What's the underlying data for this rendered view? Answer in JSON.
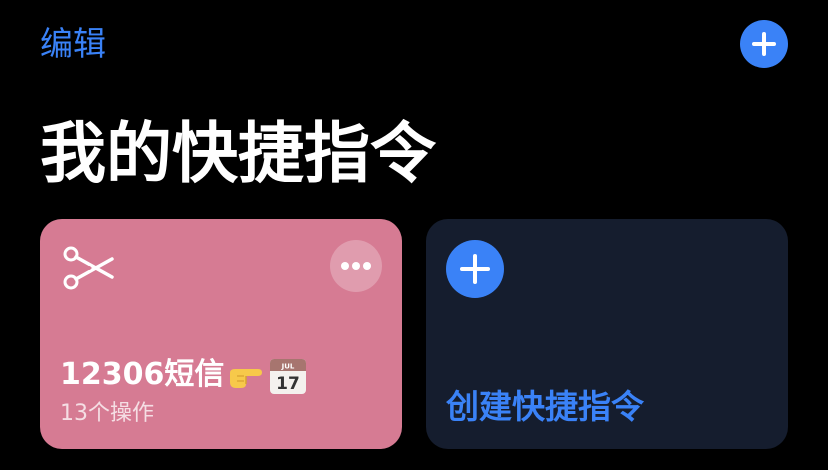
{
  "header": {
    "edit_label": "编辑",
    "add_icon": "plus-icon"
  },
  "page": {
    "title": "我的快捷指令"
  },
  "shortcuts": [
    {
      "name": "12306短信",
      "emoji_icons": [
        "pointing-right-icon",
        "calendar-icon"
      ],
      "calendar_month": "JUL",
      "calendar_day": "17",
      "action_count": "13个操作",
      "icon": "scissors-icon",
      "color": "#d67b93"
    }
  ],
  "create_card": {
    "label": "创建快捷指令",
    "icon": "plus-icon",
    "color": "#151d2e"
  },
  "colors": {
    "accent": "#3a82f7",
    "background": "#000000"
  }
}
